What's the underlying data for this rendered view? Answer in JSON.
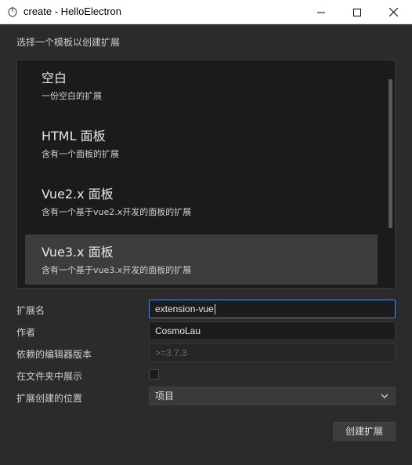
{
  "window": {
    "title": "create - HelloElectron",
    "app_icon": "electron-app-icon",
    "controls": [
      "minimize-icon",
      "maximize-icon",
      "close-icon"
    ]
  },
  "heading": "选择一个模板以创建扩展",
  "templates": [
    {
      "title": "空白",
      "description": "一份空白的扩展",
      "selected": false
    },
    {
      "title": "HTML 面板",
      "description": "含有一个面板的扩展",
      "selected": false
    },
    {
      "title": "Vue2.x 面板",
      "description": "含有一个基于vue2.x开发的面板的扩展",
      "selected": false
    },
    {
      "title": "Vue3.x 面板",
      "description": "含有一个基于vue3.x开发的面板的扩展",
      "selected": true
    }
  ],
  "form": {
    "name_label": "扩展名",
    "name_value": "extension-vue",
    "author_label": "作者",
    "author_value": "CosmoLau",
    "editor_version_label": "依赖的编辑器版本",
    "editor_version_value": ">=3.7.3",
    "show_in_folder_label": "在文件夹中展示",
    "show_in_folder_checked": false,
    "location_label": "扩展创建的位置",
    "location_value": "项目"
  },
  "actions": {
    "create_label": "创建扩展"
  },
  "colors": {
    "background": "#2b2b2b",
    "list_background": "#1b1b1b",
    "selected_item": "#3c3c3c",
    "focus_border": "#4a8fd0"
  }
}
